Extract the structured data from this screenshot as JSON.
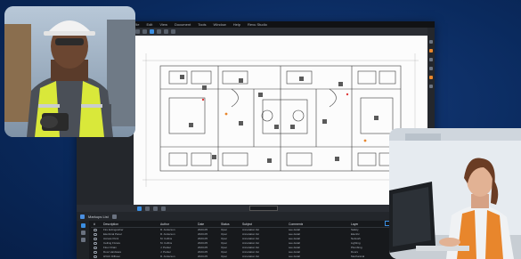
{
  "app": {
    "menu": [
      "File",
      "Edit",
      "View",
      "Document",
      "Tools",
      "Window",
      "Help",
      "Revu Studio"
    ],
    "panel_title": "Markups List"
  },
  "markups_list": {
    "columns": [
      "#",
      "Description",
      "Author",
      "Date",
      "Status",
      "Subject",
      "Comments",
      "Layer",
      "Color"
    ],
    "rows": [
      {
        "description": "Fire Extinguisher",
        "author": "R. Anderson",
        "date": "2023-05",
        "status": "Open",
        "subject": "Annotation list",
        "comments": "see detail",
        "layer": "Safety"
      },
      {
        "description": "Electrical Panel",
        "author": "R. Anderson",
        "date": "2023-05",
        "status": "Open",
        "subject": "Annotation list",
        "comments": "see detail",
        "layer": "Electric"
      },
      {
        "description": "Access Point",
        "author": "M. Collins",
        "date": "2023-05",
        "status": "Open",
        "subject": "Annotation list",
        "comments": "see detail",
        "layer": "Network"
      },
      {
        "description": "Ceiling Fixture",
        "author": "M. Collins",
        "date": "2023-05",
        "status": "Open",
        "subject": "Annotation list",
        "comments": "see detail",
        "layer": "Lighting"
      },
      {
        "description": "Floor Drain",
        "author": "J. Parker",
        "date": "2023-05",
        "status": "Open",
        "subject": "Annotation list",
        "comments": "see detail",
        "layer": "Plumbing"
      },
      {
        "description": "Door Hardware",
        "author": "J. Parker",
        "date": "2023-05",
        "status": "Open",
        "subject": "Annotation list",
        "comments": "see detail",
        "layer": "Doors"
      },
      {
        "description": "HVAC Diffuser",
        "author": "R. Anderson",
        "date": "2023-05",
        "status": "Open",
        "subject": "Annotation list",
        "comments": "see detail",
        "layer": "Mechanical"
      }
    ]
  },
  "colors": {
    "background": "#0a2a5e",
    "accent": "#3b8fe3",
    "markup_status": "#e03b3b",
    "vest": "#e8862c"
  },
  "icons": [
    "search-icon",
    "pan-icon",
    "zoom-icon",
    "markup-icon",
    "layers-icon",
    "filter-icon"
  ]
}
